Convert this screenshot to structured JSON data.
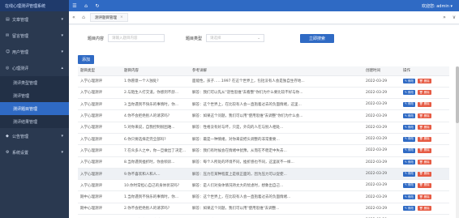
{
  "topbar": {
    "brand": "在线心理测评管理系统",
    "icons": [
      "menu-icon",
      "home-icon",
      "refresh-icon"
    ],
    "welcome": "欢迎您: admin ▾"
  },
  "sidebar": {
    "items": [
      {
        "label": "文章管理",
        "icon": "document-icon"
      },
      {
        "label": "留言管理",
        "icon": "message-icon"
      },
      {
        "label": "用户管理",
        "icon": "user-icon"
      },
      {
        "label": "心理测评",
        "icon": "psych-icon"
      }
    ],
    "sub_items": [
      {
        "label": "测评类型管理"
      },
      {
        "label": "测评管理"
      },
      {
        "label": "测评题目管理"
      },
      {
        "label": "测评结果管理"
      }
    ],
    "bottom_items": [
      {
        "label": "公告管理",
        "icon": "notice-icon"
      },
      {
        "label": "系统设置",
        "icon": "settings-icon"
      }
    ]
  },
  "tabs": {
    "prev": "«",
    "next": "»",
    "active_tab": "测评题目管理",
    "close": "×",
    "menu": "∨"
  },
  "filter": {
    "title_label": "题目内容",
    "title_placeholder": "请输入题目内容",
    "type_label": "题目类型",
    "type_placeholder": "请选择",
    "search_button": "立即搜索"
  },
  "add_button": "添加",
  "table": {
    "headers": [
      "题目类型",
      "题目内容",
      "参考详解",
      "创建时间",
      "操作"
    ],
    "rows": [
      [
        "入学心理测评",
        "1.你愿意一个人独处?",
        "面能性，孩子……1997 在这个世界上，包括没有人会是独自生存地...",
        "2022-03-29"
      ],
      [
        "入学心理测评",
        "2.与陌生人打交道，你感到不舒...",
        "解答：我们可以先从\"逆性思维\"去看整\"你们为什么要比较不好与你...",
        "2022-03-29"
      ],
      [
        "入学心理测评",
        "3.当你遇到不快乐的事情时，你...",
        "解答：这个世界上，在比较有人会一直抱着过去的负面情绪，这里...",
        "2022-03-29"
      ],
      [
        "入学心理测评",
        "4.你不会拒绝别人的请求吗?",
        "解答：如果这个问题，我们可以用\"使用思维\"去调整\"你们为什么会...",
        "2022-03-29"
      ],
      [
        "入学心理测评",
        "5.对你来说，自我控制很困难...",
        "解答：性格没有好与坏，只是，外向的人在与别人相处...",
        "2022-03-29"
      ],
      [
        "入学心理测评",
        "6.你只要选择走完全部吗?",
        "解答：最是一种情绪，对你来说把头调整的非常重要...",
        "2022-03-29"
      ],
      [
        "入学心理测评",
        "7.在众多人之中，你一旦做出了决定...",
        "解答：我们有时候会在情绪中犹豫，从而在不稳定中失去...",
        "2022-03-29"
      ],
      [
        "入学心理测评",
        "8.当你遇到挫折时，你会倾诉...",
        "解答：每个人所处的环境不同，挫折感也不同，这里就不一样...",
        "2022-03-29"
      ],
      [
        "入学心理测评",
        "9.你不喜欢和人和人...",
        "解答：压力在某种程度上是很正面的，因为压力可以促使...",
        "2022-03-29"
      ],
      [
        "入学心理测评",
        "10.你时常担心自己的身体状况吗?",
        "解答：是人们对身体情况持太大的忧虑时，想象出自己...",
        "2022-03-29"
      ],
      [
        "期中心理测评",
        "1.当你遇到不快乐的事情时，你...",
        "解答：这个世界上，在比较有人会一直抱着过去的负面情绪...",
        "2022-03-29"
      ],
      [
        "期中心理测评",
        "2.你不会拒绝别人的请求吗?",
        "解答：如果这个问题，我们可以用\"使用思维\"去调整...",
        "2022-03-29"
      ],
      [
        "期中心理测评",
        "3.你不会拒绝别人的请求吗?",
        "解答：如果这个问题，我们可以用\"使用思维\"去调整\"你们为什么会...",
        "2022-03-29"
      ]
    ],
    "edit_label": "✎ 修改",
    "delete_label": "🗑 删除"
  },
  "colors": {
    "primary": "#2f6ac4",
    "sidebar": "#2a3950",
    "danger": "#e65a43"
  }
}
